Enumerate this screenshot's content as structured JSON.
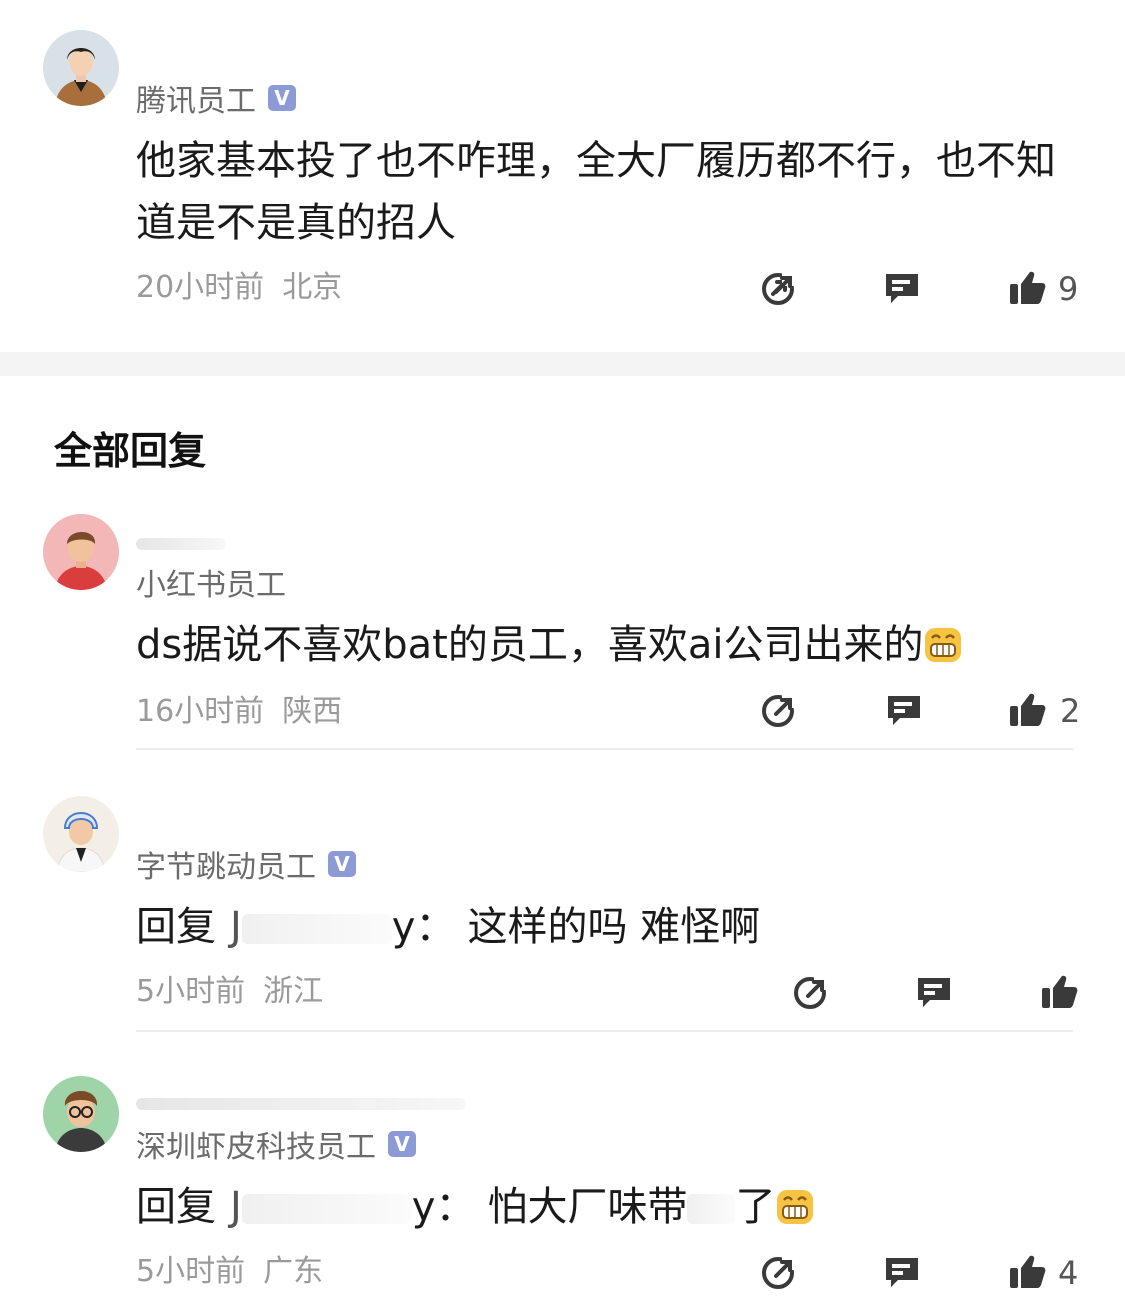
{
  "top_comment": {
    "company": "腾讯员工",
    "badge": "V",
    "text": "他家基本投了也不咋理，全大厂履历都不行，也不知道是不是真的招人",
    "time": "20小时前",
    "location": "北京",
    "likes": "9"
  },
  "section_title": "全部回复",
  "replies": [
    {
      "company": "小红书员工",
      "text": "ds据说不喜欢bat的员工，喜欢ai公司出来的",
      "time": "16小时前",
      "location": "陕西",
      "likes": "2"
    },
    {
      "company": "字节跳动员工",
      "badge": "V",
      "reply_prefix": "回复",
      "reply_target_partial_start": "J",
      "reply_target_partial_end": "y：",
      "text": "这样的吗 难怪啊",
      "time": "5小时前",
      "location": "浙江",
      "likes": ""
    },
    {
      "company": "深圳虾皮科技员工",
      "badge": "V",
      "reply_prefix": "回复",
      "reply_target_partial_start": "J",
      "reply_target_partial_end": "y：",
      "text_before": "怕大厂味带",
      "text_after": "了",
      "time": "5小时前",
      "location": "广东",
      "likes": "4"
    }
  ],
  "icons": {
    "share": "share-icon",
    "comment": "comment-icon",
    "like": "thumbs-up-icon",
    "emoji": "grin-emoji-icon"
  },
  "colors": {
    "badge": "#8c9bd6",
    "meta": "#9a9a9a",
    "icon": "#3a3a3a"
  }
}
